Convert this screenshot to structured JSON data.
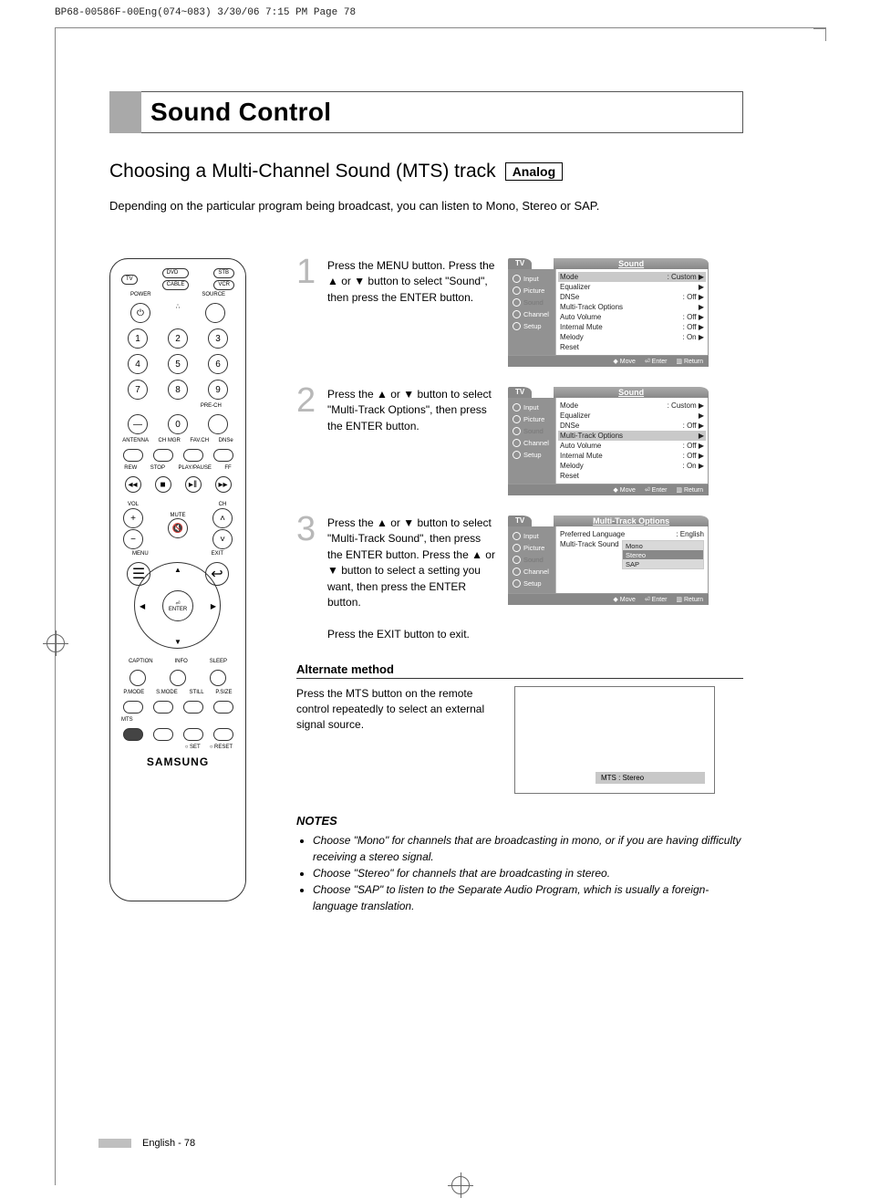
{
  "print_header": "BP68-00586F-00Eng(074~083)  3/30/06  7:15 PM  Page 78",
  "section_title": "Sound Control",
  "sub_title": "Choosing a Multi-Channel Sound (MTS) track",
  "analog_badge": "Analog",
  "intro": "Depending on the particular program being broadcast, you can listen to Mono, Stereo or SAP.",
  "remote": {
    "tv": "TV",
    "dvd": "DVD",
    "stb": "STB",
    "cable": "CABLE",
    "vcr": "VCR",
    "power": "POWER",
    "source": "SOURCE",
    "keys": [
      "1",
      "2",
      "3",
      "4",
      "5",
      "6",
      "7",
      "8",
      "9",
      "0"
    ],
    "dash": "—",
    "prech": "PRE-CH",
    "row_labels": [
      "ANTENNA",
      "CH MGR",
      "FAV.CH",
      "DNSe"
    ],
    "transport": [
      "REW",
      "STOP",
      "PLAY/PAUSE",
      "FF"
    ],
    "vol": "VOL",
    "ch": "CH",
    "mute": "MUTE",
    "menu": "MENU",
    "exit": "EXIT",
    "enter": "ENTER",
    "caption": "CAPTION",
    "info": "INFO",
    "sleep": "SLEEP",
    "bottom_row": [
      "P.MODE",
      "S.MODE",
      "STILL",
      "P.SIZE"
    ],
    "mts": "MTS",
    "set": "SET",
    "reset": "RESET",
    "brand": "SAMSUNG"
  },
  "steps": [
    {
      "num": "1",
      "text": "Press the MENU button. Press the ▲ or ▼ button to select \"Sound\", then press the ENTER button."
    },
    {
      "num": "2",
      "text": "Press the ▲ or ▼ button to select \"Multi-Track Options\", then press the ENTER button."
    },
    {
      "num": "3",
      "text": "Press the ▲ or ▼ button to select \"Multi-Track Sound\", then press the ENTER button. Press the ▲ or ▼ button to select a setting you want, then press the ENTER button.",
      "exit": "Press the EXIT button to exit."
    }
  ],
  "osd_common": {
    "tv_tab": "TV",
    "side": [
      "Input",
      "Picture",
      "Sound",
      "Channel",
      "Setup"
    ],
    "footer": [
      "◆ Move",
      "⏎ Enter",
      "▥ Return"
    ]
  },
  "osd1": {
    "title": "Sound",
    "rows": [
      {
        "l": "Mode",
        "r": ": Custom",
        "a": "▶"
      },
      {
        "l": "Equalizer",
        "r": "",
        "a": "▶"
      },
      {
        "l": "DNSe",
        "r": ": Off",
        "a": "▶"
      },
      {
        "l": "Multi-Track Options",
        "r": "",
        "a": "▶"
      },
      {
        "l": "Auto Volume",
        "r": ": Off",
        "a": "▶"
      },
      {
        "l": "Internal Mute",
        "r": ": Off",
        "a": "▶"
      },
      {
        "l": "Melody",
        "r": ": On",
        "a": "▶"
      },
      {
        "l": "Reset",
        "r": "",
        "a": ""
      }
    ],
    "sel_index": 0
  },
  "osd2": {
    "title": "Sound",
    "rows": [
      {
        "l": "Mode",
        "r": ": Custom",
        "a": "▶"
      },
      {
        "l": "Equalizer",
        "r": "",
        "a": "▶"
      },
      {
        "l": "DNSe",
        "r": ": Off",
        "a": "▶"
      },
      {
        "l": "Multi-Track Options",
        "r": "",
        "a": "▶"
      },
      {
        "l": "Auto Volume",
        "r": ": Off",
        "a": "▶"
      },
      {
        "l": "Internal Mute",
        "r": ": Off",
        "a": "▶"
      },
      {
        "l": "Melody",
        "r": ": On",
        "a": "▶"
      },
      {
        "l": "Reset",
        "r": "",
        "a": ""
      }
    ],
    "sel_index": 3
  },
  "osd3": {
    "title": "Multi-Track Options",
    "pref_label": "Preferred Language",
    "pref_value": ": English",
    "mts_label": "Multi-Track Sound",
    "options": [
      "Mono",
      "Stereo",
      "SAP"
    ],
    "active_index": 1
  },
  "alt": {
    "heading": "Alternate method",
    "text": "Press the MTS button on the remote control repeatedly to select an external signal source.",
    "banner": "MTS : Stereo"
  },
  "notes_head": "NOTES",
  "notes": [
    "Choose \"Mono\" for channels that are broadcasting in mono, or if you are having difficulty receiving a stereo signal.",
    "Choose \"Stereo\" for channels that are broadcasting in stereo.",
    "Choose \"SAP\" to listen to the Separate Audio Program, which is usually a foreign-language translation."
  ],
  "footer": "English - 78"
}
